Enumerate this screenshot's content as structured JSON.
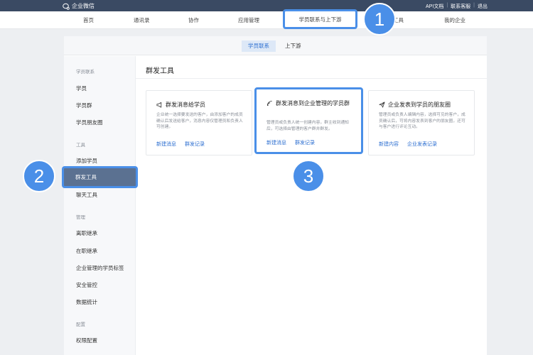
{
  "topbar": {
    "brand": "企业微信",
    "links": [
      "API文档",
      "联系客服",
      "退出"
    ]
  },
  "nav": {
    "items": [
      "首页",
      "通讯录",
      "协作",
      "应用管理",
      "学员联系与上下游",
      "工具",
      "我的企业"
    ]
  },
  "subtabs": [
    "学员联系",
    "上下游"
  ],
  "sidebar": {
    "groups": [
      {
        "title": "学员联系",
        "items": [
          "学员",
          "学员群",
          "学员朋友圈"
        ]
      },
      {
        "title": "工具",
        "items": [
          "添加学员",
          "群发工具",
          "聊天工具"
        ]
      },
      {
        "title": "管理",
        "items": [
          "离职继承",
          "在职继承",
          "企业管理的学员标签",
          "安全管控",
          "数据统计"
        ]
      },
      {
        "title": "配置",
        "items": [
          "权限配置"
        ]
      }
    ]
  },
  "panel": {
    "title": "群发工具",
    "cards": [
      {
        "title": "群发消息给学员",
        "desc": "企业统一选择要发送的客户，由添加客户的成员确认后发送给客户，消息内容仅管理员和负责人可创建。",
        "links": [
          "新建消息",
          "群发记录"
        ]
      },
      {
        "title": "群发消息到企业管理的学员群",
        "desc": "管理员或负责人统一创建内容，群主收到通知后，可选择由管理的客户群并群发。",
        "links": [
          "新建消息",
          "群发记录"
        ]
      },
      {
        "title": "企业发表到学员的朋友圈",
        "desc": "管理员或负责人编辑内容，选择可见的客户，成员确认后，可将内容发表到客户的朋友圈，还可与客户进行评论互动。",
        "links": [
          "新建内容",
          "企业发表记录"
        ]
      }
    ]
  },
  "steps": [
    "1",
    "2",
    "3"
  ],
  "colors": {
    "topbar": "#3a4a63",
    "accent": "#4a8fe8",
    "link": "#2d6fd1",
    "active_sidebar": "#5b7191"
  }
}
